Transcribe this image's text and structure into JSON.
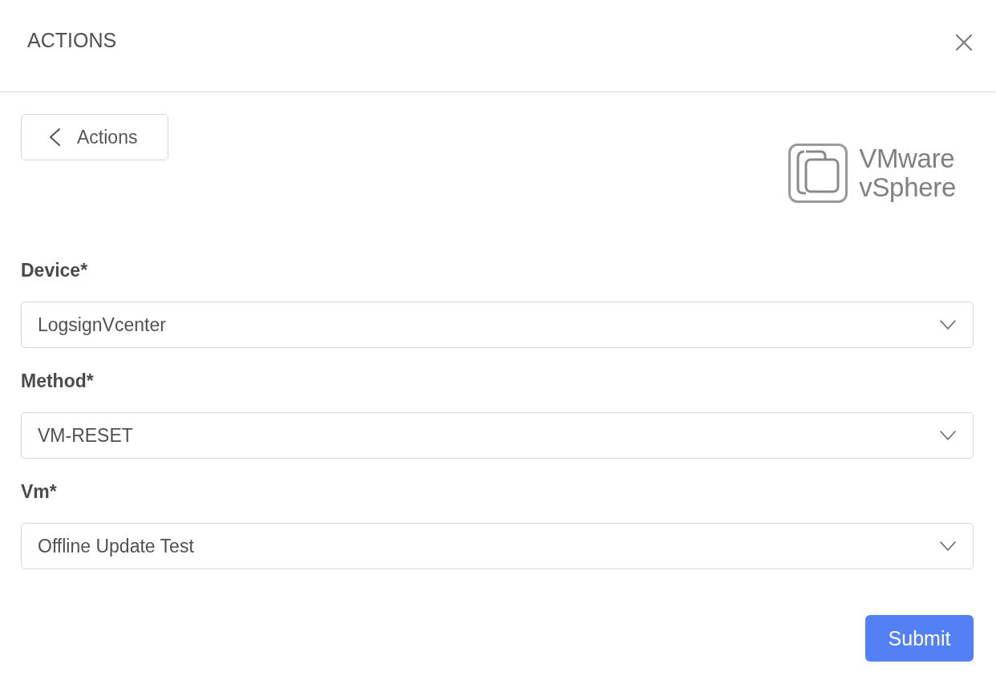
{
  "dialog": {
    "title": "ACTIONS"
  },
  "back_button": {
    "label": "Actions"
  },
  "logo": {
    "lines": [
      "VMware",
      "vSphere"
    ]
  },
  "fields": [
    {
      "label": "Device*",
      "value": "LogsignVcenter"
    },
    {
      "label": "Method*",
      "value": "VM-RESET"
    },
    {
      "label": "Vm*",
      "value": "Offline Update Test"
    }
  ],
  "submit_button": {
    "label": "Submit"
  }
}
